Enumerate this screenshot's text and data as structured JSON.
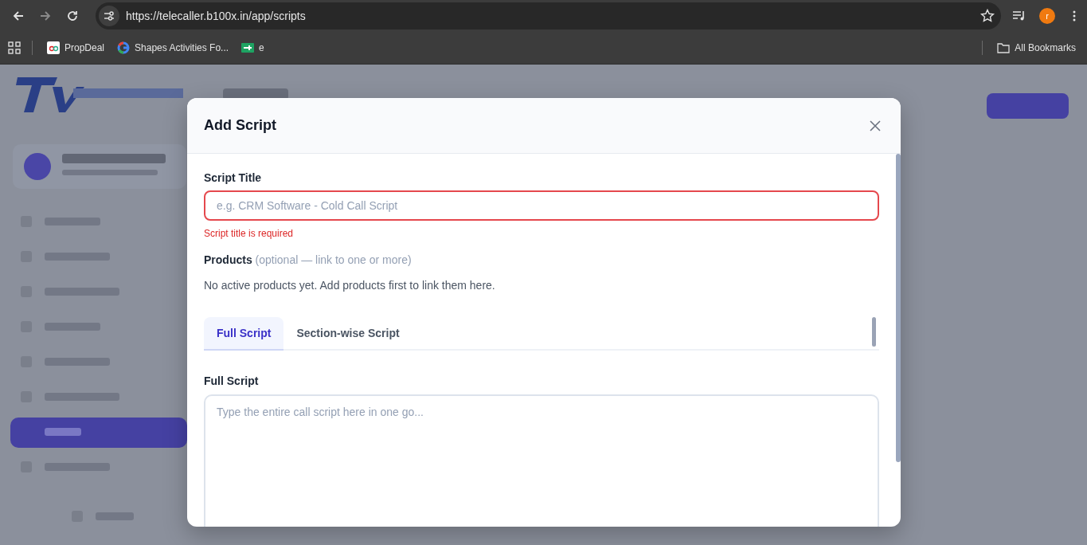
{
  "browser": {
    "url": "https://telecaller.b100x.in/app/scripts",
    "profile_initial": "r",
    "bookmarks": [
      {
        "label": "PropDeal",
        "kind": "propdeal"
      },
      {
        "label": "Shapes Activities Fo...",
        "kind": "google"
      },
      {
        "label": "e",
        "kind": "sheet"
      }
    ],
    "all_bookmarks": "All Bookmarks"
  },
  "modal": {
    "title": "Add Script",
    "title_field": {
      "label": "Script Title",
      "placeholder": "e.g. CRM Software - Cold Call Script",
      "error": "Script title is required"
    },
    "products": {
      "label": "Products",
      "hint": "(optional — link to one or more)",
      "empty_text": "No active products yet. Add products first to link them here."
    },
    "tabs": [
      {
        "label": "Full Script",
        "selected": true
      },
      {
        "label": "Section-wise Script",
        "selected": false
      }
    ],
    "script_field": {
      "label": "Full Script",
      "placeholder": "Type the entire call script here in one go..."
    }
  }
}
